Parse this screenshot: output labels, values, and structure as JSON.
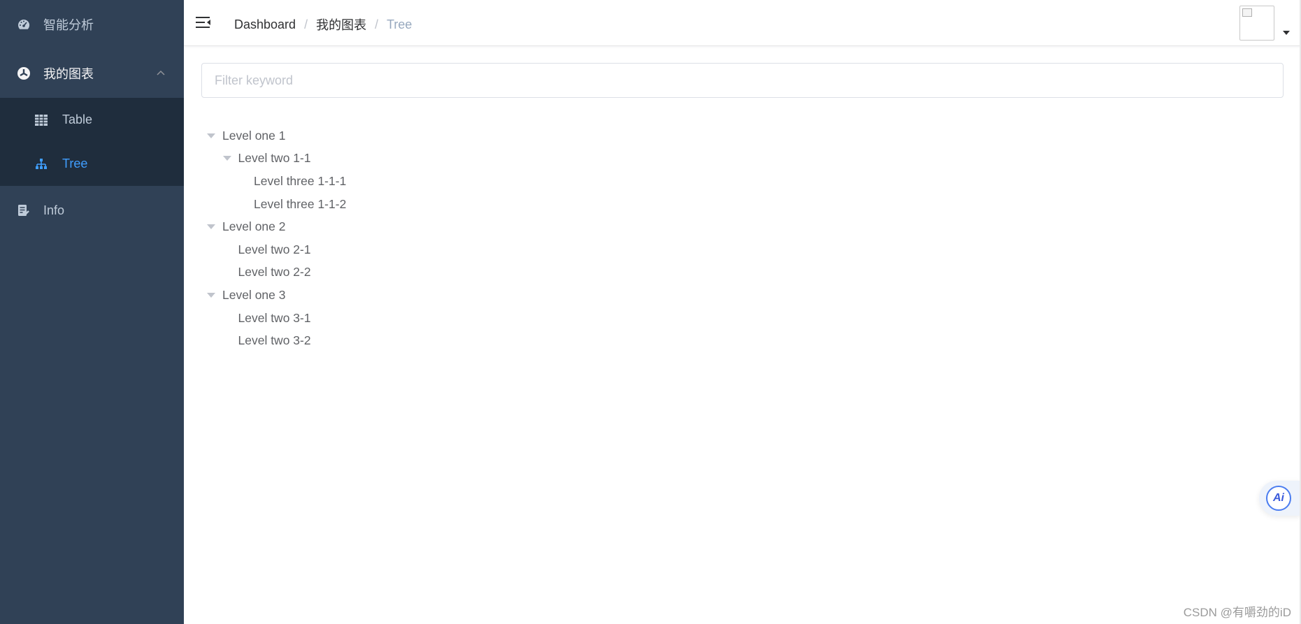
{
  "sidebar": {
    "items": [
      {
        "label": "智能分析",
        "icon": "dashboard-gauge-icon"
      },
      {
        "label": "我的图表",
        "icon": "chart-circle-icon",
        "expanded": true,
        "children": [
          {
            "label": "Table",
            "icon": "table-icon"
          },
          {
            "label": "Tree",
            "icon": "tree-icon",
            "active": true
          }
        ]
      },
      {
        "label": "Info",
        "icon": "form-icon"
      }
    ]
  },
  "navbar": {
    "breadcrumb": [
      "Dashboard",
      "我的图表",
      "Tree"
    ],
    "separator": "/"
  },
  "filter": {
    "placeholder": "Filter keyword",
    "value": ""
  },
  "tree": {
    "nodes": [
      {
        "label": "Level one 1",
        "level": 1,
        "expanded": true
      },
      {
        "label": "Level two 1-1",
        "level": 2,
        "expanded": true
      },
      {
        "label": "Level three 1-1-1",
        "level": 3,
        "leaf": true
      },
      {
        "label": "Level three 1-1-2",
        "level": 3,
        "leaf": true
      },
      {
        "label": "Level one 2",
        "level": 1,
        "expanded": true
      },
      {
        "label": "Level two 2-1",
        "level": 2,
        "leaf": true
      },
      {
        "label": "Level two 2-2",
        "level": 2,
        "leaf": true
      },
      {
        "label": "Level one 3",
        "level": 1,
        "expanded": true
      },
      {
        "label": "Level two 3-1",
        "level": 2,
        "leaf": true
      },
      {
        "label": "Level two 3-2",
        "level": 2,
        "leaf": true
      }
    ]
  },
  "ai_button": {
    "label": "Ai"
  },
  "watermark": "CSDN @有嚼劲的iD",
  "colors": {
    "sidebar_bg": "#304156",
    "submenu_bg": "#1f2d3d",
    "active": "#409eff"
  }
}
